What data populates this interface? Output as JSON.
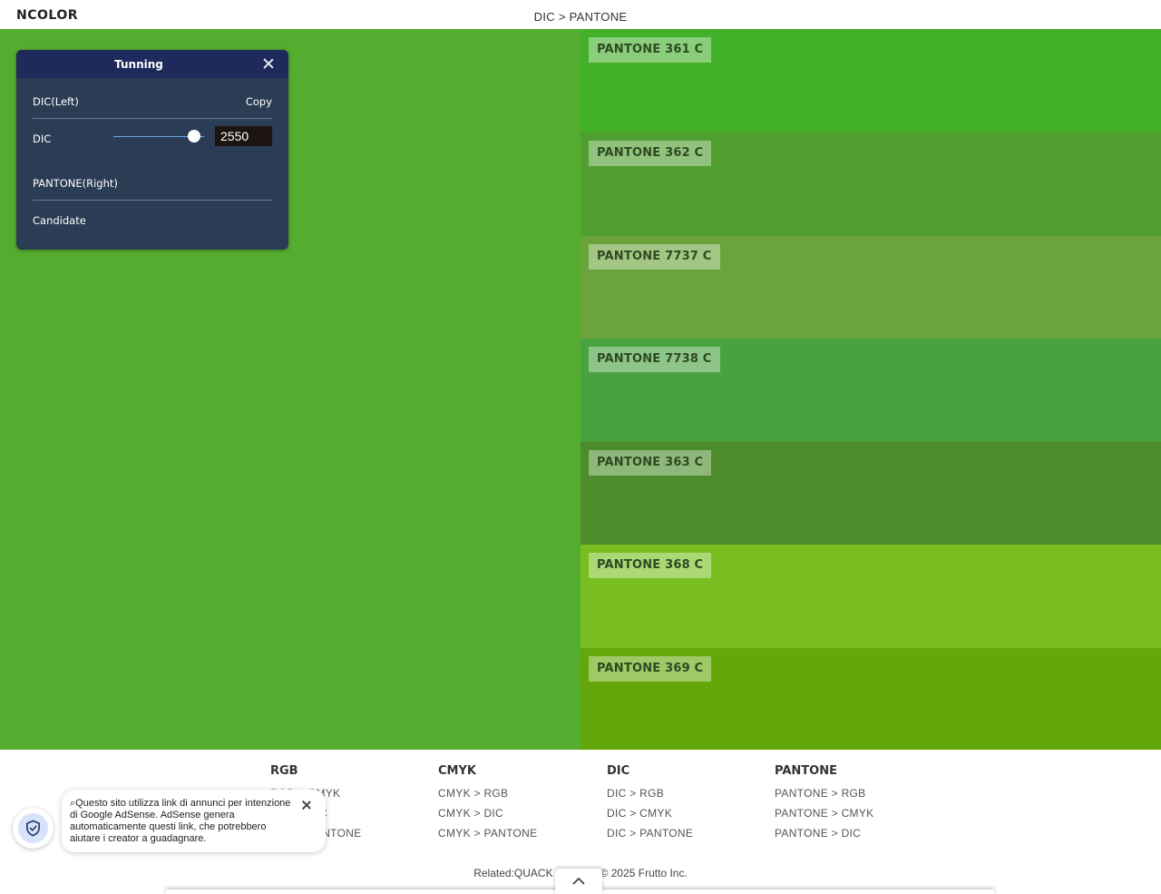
{
  "header": {
    "logo": "NCOLOR",
    "breadcrumb": "DIC > PANTONE"
  },
  "colors": {
    "left_swatch": "#55ad2f",
    "panel_bg": "#2b3d55",
    "panel_header": "#1e2a5c"
  },
  "panel": {
    "title": "Tunning",
    "left_label": "DIC(Left)",
    "copy_label": "Copy",
    "dic_label": "DIC",
    "dic_value": "2550",
    "right_label": "PANTONE(Right)",
    "candidate_label": "Candidate",
    "close_icon": "close-icon"
  },
  "swatches": [
    {
      "label": "PANTONE 361 C",
      "color": "#43b02a"
    },
    {
      "label": "PANTONE 362 C",
      "color": "#509e2f"
    },
    {
      "label": "PANTONE 7737 C",
      "color": "#6ba43a"
    },
    {
      "label": "PANTONE 7738 C",
      "color": "#48a23f"
    },
    {
      "label": "PANTONE 363 C",
      "color": "#4c8c2b"
    },
    {
      "label": "PANTONE 368 C",
      "color": "#78be20"
    },
    {
      "label": "PANTONE 369 C",
      "color": "#64a70b"
    }
  ],
  "footer": {
    "columns": [
      {
        "heading": "RGB",
        "links": [
          "RGB > CMYK",
          "RGB > DIC",
          "RGB > PANTONE"
        ]
      },
      {
        "heading": "CMYK",
        "links": [
          "CMYK > RGB",
          "CMYK > DIC",
          "CMYK > PANTONE"
        ]
      },
      {
        "heading": "DIC",
        "links": [
          "DIC > RGB",
          "DIC > CMYK",
          "DIC > PANTONE"
        ]
      },
      {
        "heading": "PANTONE",
        "links": [
          "PANTONE > RGB",
          "PANTONE > CMYK",
          "PANTONE > DIC"
        ]
      }
    ],
    "related": "Related:QUACK WORKS  © 2025 Frutto Inc."
  },
  "ad_notice": {
    "text": "Questo sito utilizza link di annunci per intenzione di Google AdSense. AdSense genera automaticamente questi link, che potrebbero aiutare i creator a guadagnare.",
    "icon": "shield-check-icon"
  }
}
